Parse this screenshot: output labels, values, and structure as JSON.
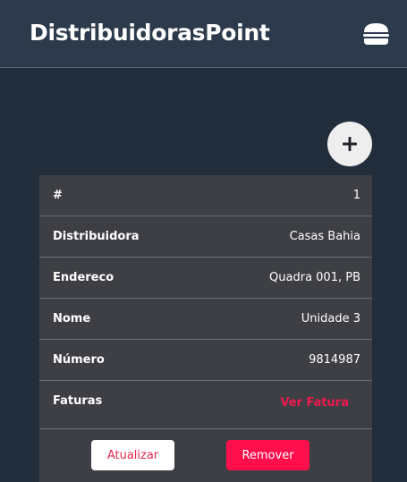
{
  "navbar": {
    "brand": "DistribuidorasPoint",
    "menu_icon": "hamburger-icon"
  },
  "add_button": {
    "icon": "plus-icon",
    "label": "+"
  },
  "record": {
    "rows": [
      {
        "label": "#",
        "value": "1"
      },
      {
        "label": "Distribuidora",
        "value": "Casas Bahia"
      },
      {
        "label": "Endereco",
        "value": "Quadra 001, PB"
      },
      {
        "label": "Nome",
        "value": "Unidade 3"
      },
      {
        "label": "Número",
        "value": "9814987"
      },
      {
        "label": "Faturas",
        "value": "Ver Fatura"
      }
    ],
    "actions": {
      "update_label": "Atualizar",
      "remove_label": "Remover"
    }
  },
  "colors": {
    "background": "#212d3b",
    "navbar": "#2c3a4c",
    "card": "#3d3f44",
    "accent": "#ff0f4b",
    "link": "#f0194d"
  }
}
